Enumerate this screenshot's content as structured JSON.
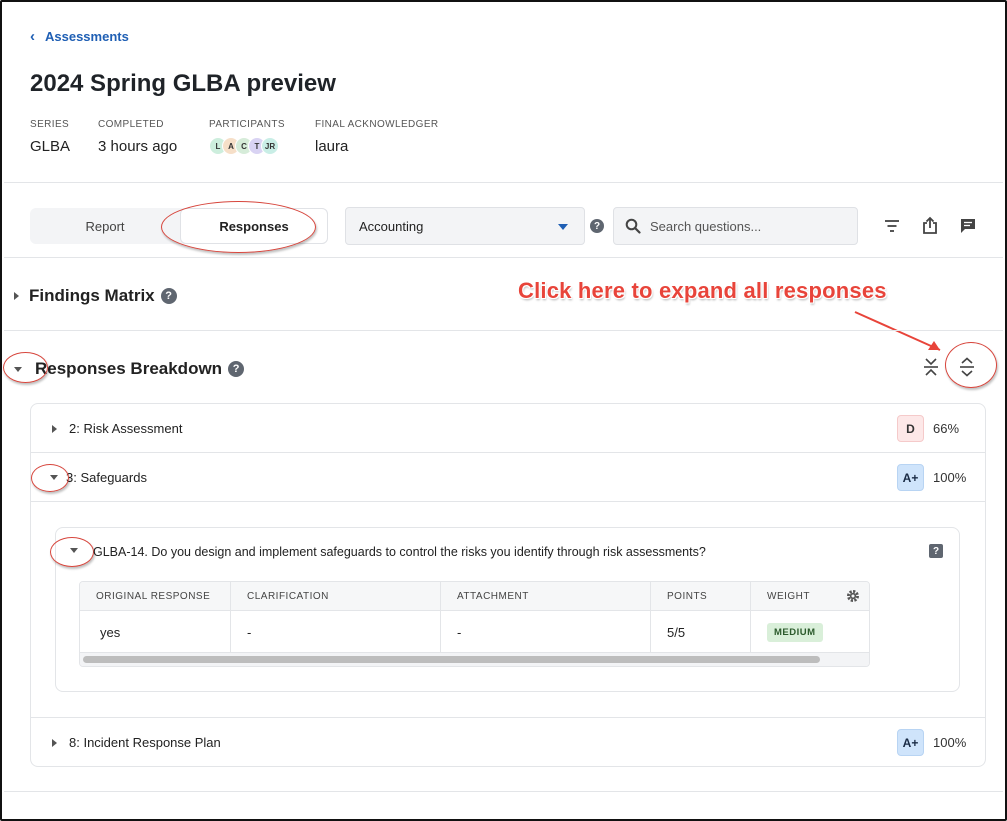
{
  "breadcrumb": {
    "back_label": "Assessments"
  },
  "page": {
    "title": "2024 Spring GLBA preview"
  },
  "meta": {
    "series_label": "SERIES",
    "series_value": "GLBA",
    "completed_label": "COMPLETED",
    "completed_value": "3 hours ago",
    "participants_label": "PARTICIPANTS",
    "participants": [
      {
        "initials": "L",
        "color": "#cdeedd"
      },
      {
        "initials": "A",
        "color": "#f6dfc8"
      },
      {
        "initials": "C",
        "color": "#d6ecd9"
      },
      {
        "initials": "T",
        "color": "#d9d3f3"
      },
      {
        "initials": "JR",
        "color": "#c9eee6"
      }
    ],
    "acknowledger_label": "FINAL ACKNOWLEDGER",
    "acknowledger_value": "laura"
  },
  "toolbar": {
    "tab_report": "Report",
    "tab_responses": "Responses",
    "department_selected": "Accounting",
    "search_placeholder": "Search questions..."
  },
  "findings": {
    "title": "Findings Matrix"
  },
  "annotation": {
    "callout": "Click here to expand all responses"
  },
  "breakdown": {
    "title": "Responses Breakdown",
    "sections": [
      {
        "label": "2: Risk Assessment",
        "grade": "D",
        "percent": "66%"
      },
      {
        "label": "3: Safeguards",
        "grade": "A+",
        "percent": "100%"
      },
      {
        "label": "8: Incident Response Plan",
        "grade": "A+",
        "percent": "100%"
      }
    ],
    "question": {
      "text": "GLBA-14. Do you design and implement safeguards to control the risks you identify through risk assessments?",
      "columns": [
        "ORIGINAL RESPONSE",
        "CLARIFICATION",
        "ATTACHMENT",
        "POINTS",
        "WEIGHT"
      ],
      "row": {
        "response": "yes",
        "clarification": "-",
        "attachment": "-",
        "points": "5/5",
        "weight": "MEDIUM"
      }
    }
  },
  "colors": {
    "accent": "#1f5fb4",
    "annotation": "#e8443a"
  }
}
